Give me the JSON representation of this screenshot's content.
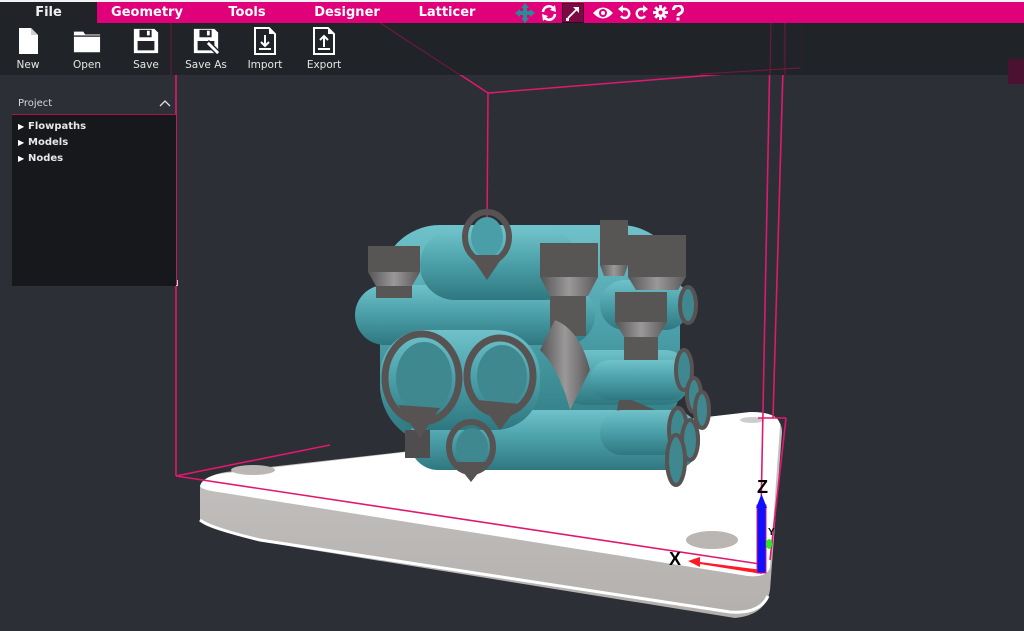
{
  "menu": {
    "tabs": [
      {
        "label": "File",
        "active": true
      },
      {
        "label": "Geometry",
        "active": false
      },
      {
        "label": "Tools",
        "active": false
      },
      {
        "label": "Designer",
        "active": false
      },
      {
        "label": "Latticer",
        "active": false
      }
    ],
    "view_tools": [
      {
        "icon": "move-arrows-icon",
        "active": false
      },
      {
        "icon": "rotate-icon",
        "active": false
      },
      {
        "icon": "scale-icon",
        "active": true
      },
      {
        "icon": "eye-icon",
        "active": false
      },
      {
        "icon": "undo-icon",
        "active": false
      },
      {
        "icon": "redo-icon",
        "active": false
      },
      {
        "icon": "gear-icon",
        "active": false
      },
      {
        "icon": "help-icon",
        "active": false
      }
    ]
  },
  "toolbar": {
    "buttons": [
      {
        "label": "New",
        "icon": "new-file-icon"
      },
      {
        "label": "Open",
        "icon": "folder-icon"
      },
      {
        "label": "Save",
        "icon": "floppy-icon"
      },
      {
        "label": "Save As",
        "icon": "floppy-edit-icon"
      },
      {
        "label": "Import",
        "icon": "import-icon"
      },
      {
        "label": "Export",
        "icon": "export-icon"
      }
    ]
  },
  "project": {
    "title": "Project",
    "items": [
      {
        "label": "Flowpaths"
      },
      {
        "label": "Models"
      },
      {
        "label": "Nodes"
      }
    ]
  },
  "axes": {
    "x_label": "X",
    "y_label": "Y",
    "z_label": "Z"
  },
  "colors": {
    "accent": "#e0007a",
    "background": "#2c2f36",
    "model_teal": "#4a9aa3",
    "model_gray": "#5a5757",
    "platform": "#ffffff"
  }
}
